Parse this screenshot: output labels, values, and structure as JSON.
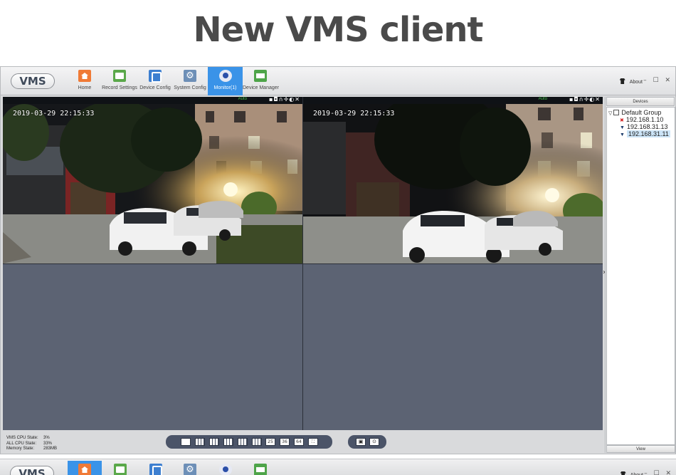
{
  "banner": {
    "title": "New VMS client"
  },
  "app": {
    "logo": "VMS",
    "toolbar": [
      {
        "label": "Home",
        "icon": "home-icon"
      },
      {
        "label": "Record Settings",
        "icon": "record-settings-icon"
      },
      {
        "label": "Device Config",
        "icon": "device-config-icon"
      },
      {
        "label": "System Config",
        "icon": "system-config-icon"
      },
      {
        "label": "Monitor(1)",
        "icon": "monitor-icon",
        "active": true
      },
      {
        "label": "Device Manager",
        "icon": "device-manager-icon"
      }
    ],
    "about": "About",
    "window_controls": "– ☐ ✕"
  },
  "video": {
    "panes": [
      {
        "osd": "2019-03-29 22:15:33",
        "mode": "Auto",
        "controls": "▪◘∩✛◐✕"
      },
      {
        "osd": "2019-03-29 22:15:33",
        "mode": "Auto",
        "controls": "▪◘∩✛◐✕"
      }
    ]
  },
  "devices": {
    "header": "Devices",
    "group": "Default Group",
    "items": [
      {
        "ip": "192.168.1.10",
        "status": "offline",
        "glyph": "✖"
      },
      {
        "ip": "192.168.31.13",
        "status": "online",
        "glyph": "▼"
      },
      {
        "ip": "192.168.31.11",
        "status": "online",
        "glyph": "▼",
        "selected": true
      }
    ],
    "footer": "View"
  },
  "status": {
    "vms_cpu_label": "VMS CPU State:",
    "vms_cpu": "3%",
    "all_cpu_label": "ALL CPU State:",
    "all_cpu": "33%",
    "memory_label": "Memory State:",
    "memory": "283MB"
  },
  "layout_buttons": {
    "l25": "25",
    "l36": "36",
    "l64": "64"
  },
  "colors": {
    "accent": "#3a93e8",
    "video_bg": "#5c6373",
    "osd_text": "#ffffff",
    "auto_text": "#48c24d"
  }
}
